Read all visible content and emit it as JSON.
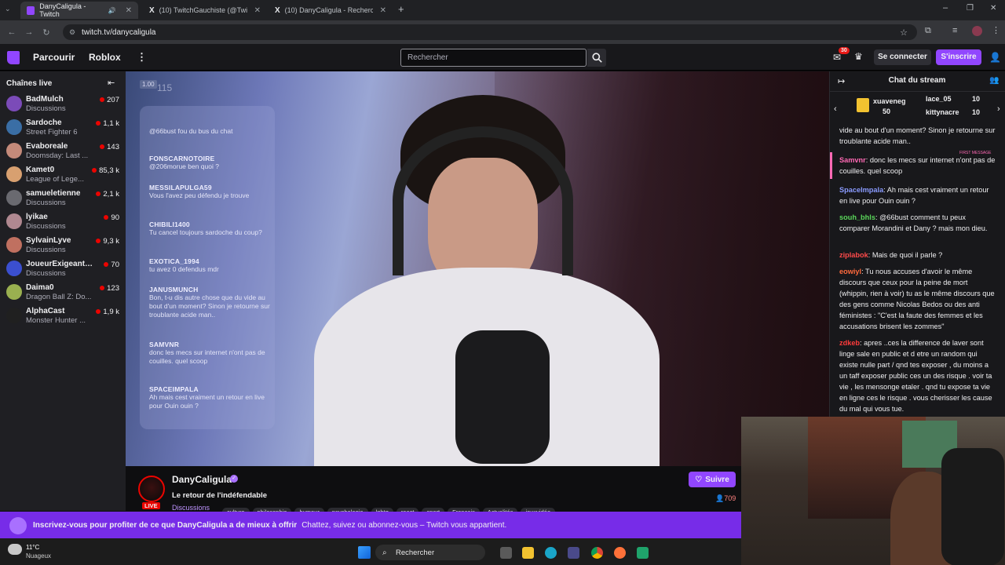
{
  "browser": {
    "tabs": [
      {
        "title": "DanyCaligula - Twitch",
        "active": true
      },
      {
        "title": "(10) TwitchGauchiste (@Twitch…",
        "active": false
      },
      {
        "title": "(10) DanyCaligula - Recherche …",
        "active": false
      }
    ],
    "url": "twitch.tv/danycaligula"
  },
  "twitch_nav": {
    "browse": "Parcourir",
    "game": "Roblox",
    "search_placeholder": "Rechercher",
    "notif_count": "30",
    "login": "Se connecter",
    "signup": "S'inscrire"
  },
  "sidebar": {
    "title": "Chaînes live",
    "channels": [
      {
        "name": "BadMulch",
        "game": "Discussions",
        "viewers": "207",
        "color": "#7b4bb8"
      },
      {
        "name": "Sardoche",
        "game": "Street Fighter 6",
        "viewers": "1,1 k",
        "color": "#3a6ea5"
      },
      {
        "name": "Evaboreale",
        "game": "Doomsday: Last ...",
        "viewers": "143",
        "color": "#c48a7a"
      },
      {
        "name": "Kamet0",
        "game": "League of Lege...",
        "viewers": "85,3 k",
        "color": "#d8a070"
      },
      {
        "name": "samueletienne",
        "game": "Discussions",
        "viewers": "2,1 k",
        "color": "#6a6a70"
      },
      {
        "name": "lyikae",
        "game": "Discussions",
        "viewers": "90",
        "color": "#b08890"
      },
      {
        "name": "SylvainLyve",
        "game": "Discussions",
        "viewers": "9,3 k",
        "color": "#c07060"
      },
      {
        "name": "JoueurExigeantLi...",
        "game": "Discussions",
        "viewers": "70",
        "color": "#3b4fd0"
      },
      {
        "name": "Daima0",
        "game": "Dragon Ball Z: Do...",
        "viewers": "123",
        "color": "#9ab050"
      },
      {
        "name": "AlphaCast",
        "game": "Monster Hunter ...",
        "viewers": "1,9 k",
        "color": "#202020"
      }
    ]
  },
  "video_overlay": {
    "top_label": "1.00",
    "top_num": "115",
    "messages": [
      {
        "user": "",
        "msg": "@66bust fou du bus du chat"
      },
      {
        "user": "FONSCARNOTOIRE",
        "msg": "@206morue ben quoi ?"
      },
      {
        "user": "MESSILAPULGA59",
        "msg": "Vous l'avez peu défendu je trouve"
      },
      {
        "user": "CHIBILI1400",
        "msg": "Tu cancel toujours sardoche du coup?"
      },
      {
        "user": "EXOTICA_1994",
        "msg": "tu avez 0 defendus mdr"
      },
      {
        "user": "JANUSMUNCH",
        "msg": "Bon, t-u dis autre chose que du vide au bout d'un moment? Sinon je retourne sur troublante acide man.."
      },
      {
        "user": "SAMVNR",
        "msg": "donc les mecs sur internet n'ont pas de couilles. quel scoop"
      },
      {
        "user": "SPACEIMPALA",
        "msg": "Ah mais cest vraiment un retour en live pour Ouin ouin ?"
      }
    ]
  },
  "channel_info": {
    "name": "DanyCaligula",
    "title": "Le retour de l'indéfendable",
    "live": "LIVE",
    "category": "Discussions",
    "tags": [
      "culture",
      "philosophie",
      "humour",
      "psychologie",
      "lgbtq",
      "react",
      "sport",
      "Français",
      "Actualités",
      "jeuxvidéo"
    ],
    "follow": "Suivre",
    "viewers": "709"
  },
  "banner": {
    "text": "Inscrivez-vous pour profiter de ce que DanyCaligula a de mieux à offrir",
    "subtext": "Chattez, suivez ou abonnez-vous – Twitch vous appartient."
  },
  "chat": {
    "title": "Chat du stream",
    "gifters": [
      {
        "name": "xuaveneg",
        "count": "50"
      },
      {
        "name": "lace_05",
        "count": "10"
      },
      {
        "name": "kittynacre",
        "count": "10"
      }
    ],
    "first_message_label": "FIRST MESSAGE",
    "messages": [
      {
        "user": "",
        "color": "#efeff1",
        "text": "vide au bout d'un moment? Sinon je retourne sur troublante acide man.."
      },
      {
        "user": "Samvnr",
        "color": "#ff69b4",
        "text": "donc les mecs sur internet n'ont pas de couilles. quel scoop"
      },
      {
        "user": "SpaceImpala",
        "color": "#8a9bff",
        "text": "Ah mais cest vraiment un retour en live pour Ouin ouin ?"
      },
      {
        "user": "souh_bhls",
        "color": "#5ad65a",
        "text": "@66bust comment tu peux comparer Morandini et Dany ? mais mon dieu."
      },
      {
        "user": "ziplabok",
        "color": "#ff4a4a",
        "text": "Mais de quoi il parle ?"
      },
      {
        "user": "eowiyl",
        "color": "#ff6a3d",
        "text": "Tu nous accuses d'avoir le même discours que ceux pour la peine de mort (whippin, rien à voir) tu as le même discours que des gens comme Nicolas Bedos ou des anti féministes : \"C'est la faute des femmes et les accusations brisent les zommes\""
      },
      {
        "user": "zdkeb",
        "color": "#ff3b3b",
        "text": "apres ..ces la difference de laver sont linge sale en public et d etre un random qui existe nulle part / qnd tes exposer , du moins a un taff exposer public ces un des risque . voir ta vie , les mensonge etaler . qnd tu expose ta vie en ligne ces le risque . vous cherisser les cause du mal qui vous tue."
      }
    ]
  },
  "taskbar": {
    "temp": "11°C",
    "weather": "Nuageux",
    "search": "Rechercher"
  }
}
